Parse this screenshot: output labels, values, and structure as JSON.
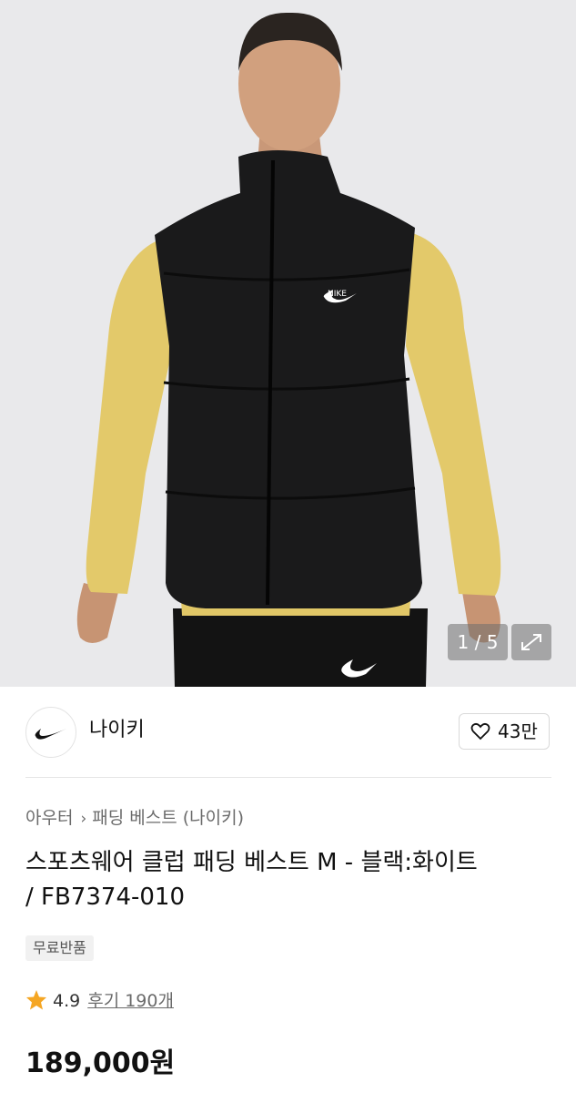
{
  "gallery": {
    "counter": "1 / 5",
    "jacket_logo": "NIKE"
  },
  "brand": {
    "name": "나이키",
    "logo": "nike-swoosh-icon"
  },
  "wishlist": {
    "count": "43만",
    "icon": "heart-icon"
  },
  "breadcrumb": {
    "items": [
      "아우터",
      "패딩 베스트 (나이키)"
    ]
  },
  "product": {
    "title_line1": "스포츠웨어 클럽 패딩 베스트 M - 블랙:화이트",
    "title_line2": "/ FB7374-010",
    "badge": "무료반품",
    "rating": "4.9",
    "reviews": "후기 190개",
    "price": "189,000원"
  },
  "colors": {
    "accent_star": "#F5A623",
    "text_primary": "#111111",
    "text_secondary": "#6B6B6B"
  }
}
